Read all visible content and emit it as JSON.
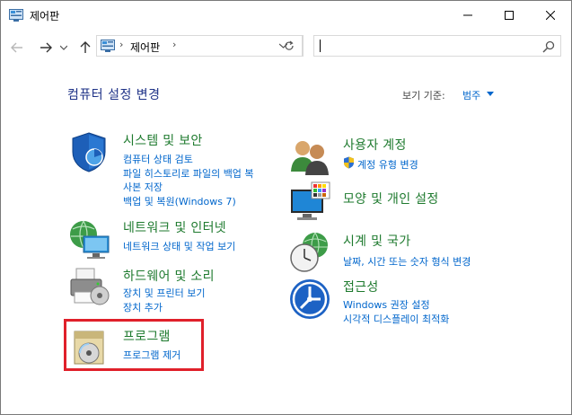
{
  "window": {
    "title": "제어판",
    "controls": {
      "minimize": "minimize-icon",
      "maximize": "maximize-icon",
      "close": "close-icon"
    }
  },
  "address": {
    "path": "제어판",
    "separator": "›",
    "search_placeholder": ""
  },
  "main": {
    "title": "컴퓨터 설정 변경",
    "view_by_label": "보기 기준:",
    "view_by_value": "범주"
  },
  "categories": {
    "system_security": {
      "title": "시스템 및 보안",
      "links": [
        "컴퓨터 상태 검토",
        "파일 히스토리로 파일의 백업 복",
        "사본 저장",
        "백업 및 복원(Windows 7)"
      ]
    },
    "network": {
      "title": "네트워크 및 인터넷",
      "links": [
        "네트워크 상태 및 작업 보기"
      ]
    },
    "hardware": {
      "title": "하드웨어 및 소리",
      "links": [
        "장치 및 프린터 보기",
        "장치 추가"
      ]
    },
    "programs": {
      "title": "프로그램",
      "links": [
        "프로그램 제거"
      ]
    },
    "user_accounts": {
      "title": "사용자 계정",
      "links": [
        "계정 유형 변경"
      ]
    },
    "appearance": {
      "title": "모양 및 개인 설정",
      "links": []
    },
    "clock_region": {
      "title": "시계 및 국가",
      "links": [
        "날짜, 시간 또는 숫자 형식 변경"
      ]
    },
    "ease_of_access": {
      "title": "접근성",
      "links": [
        "Windows 권장 설정",
        "시각적 디스플레이 최적화"
      ]
    }
  },
  "colors": {
    "category_title": "#1e7a2e",
    "link": "#0066cc",
    "heading": "#1e3287",
    "highlight_border": "#e0202a"
  }
}
